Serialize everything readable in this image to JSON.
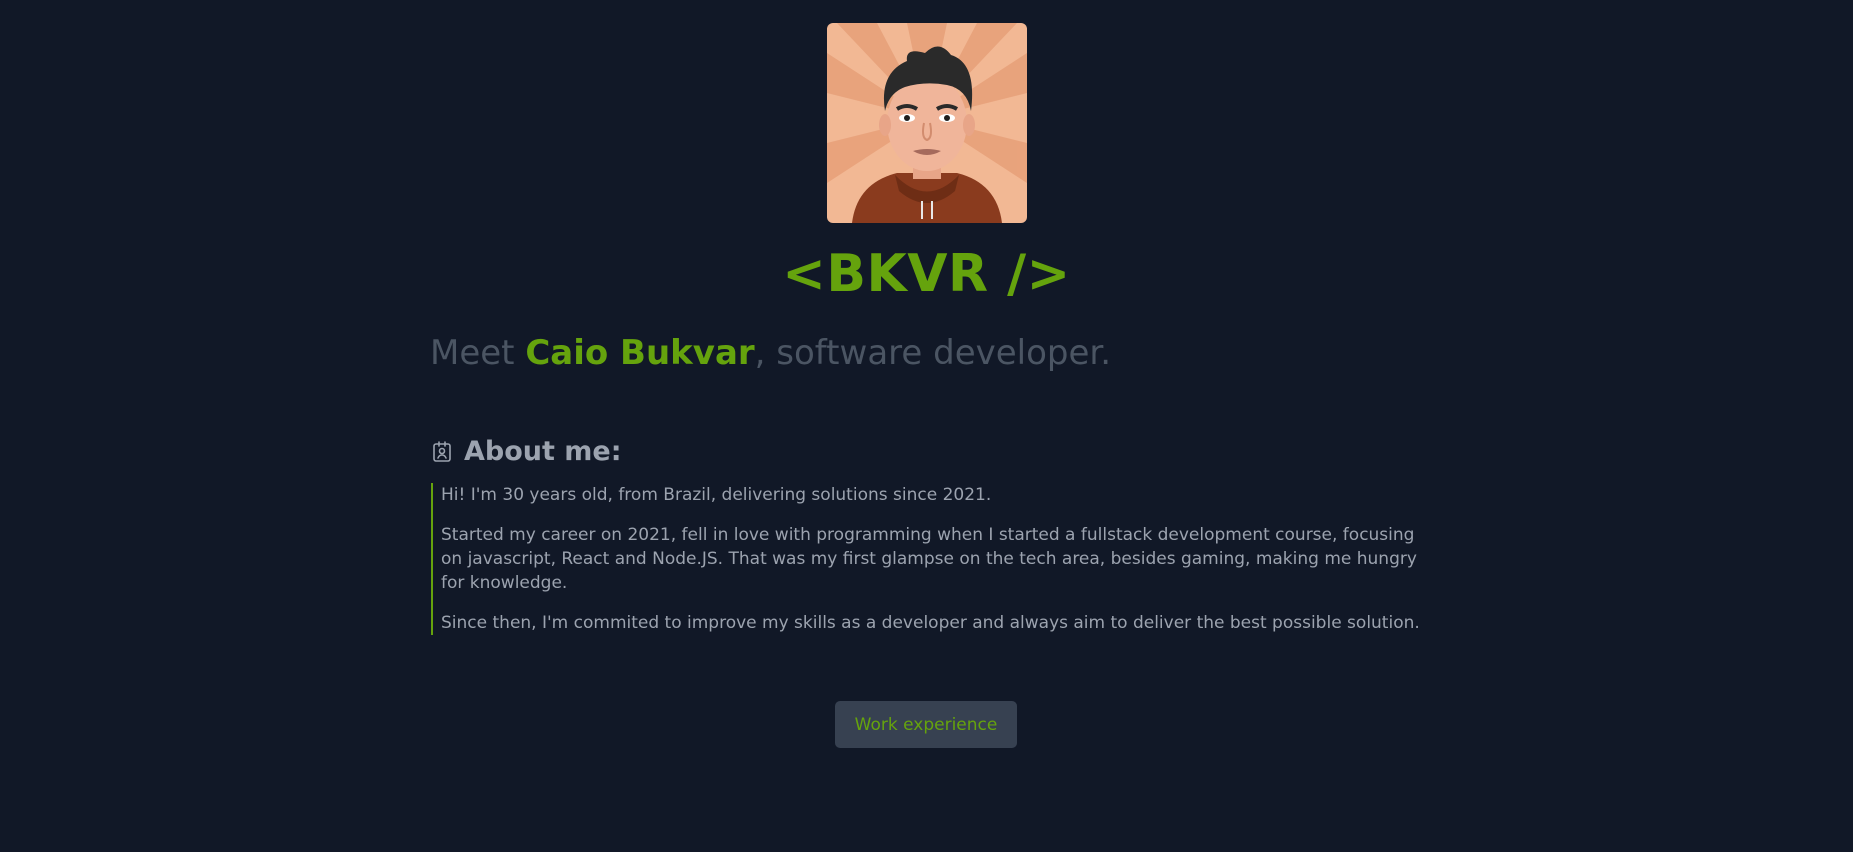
{
  "header": {
    "logo": "<BKVR />"
  },
  "hero": {
    "prefix": "Meet ",
    "name": "Caio Bukvar",
    "suffix": ", software developer."
  },
  "about": {
    "icon": "id-badge-icon",
    "title": "About me:",
    "paragraphs": [
      "Hi! I'm 30 years old, from Brazil, delivering solutions since 2021.",
      "Started my career on 2021, fell in love with programming when I started a fullstack development course, focusing on javascript, React and Node.JS. That was my first glampse on the tech area, besides gaming, making me hungry for knowledge.",
      "Since then, I'm commited to improve my skills as a developer and always aim to deliver the best possible solution."
    ]
  },
  "actions": {
    "work_experience_label": "Work experience"
  },
  "colors": {
    "background": "#111827",
    "accent": "#65a30d",
    "muted_text": "#9ca3af",
    "dim_text": "#4b5563",
    "button_bg": "#374151"
  }
}
